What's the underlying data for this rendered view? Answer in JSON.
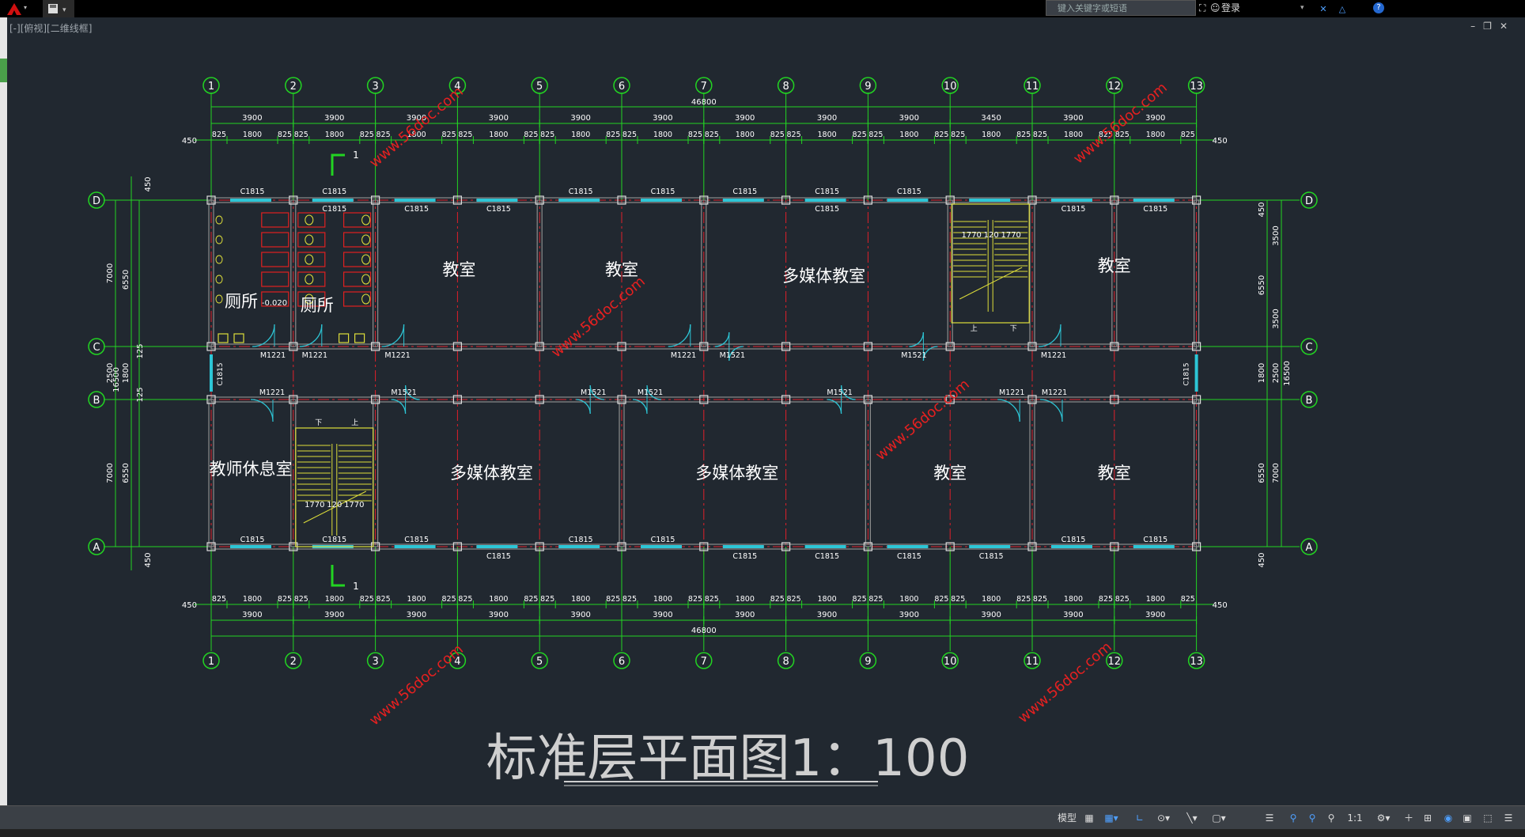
{
  "app": {
    "viewport_label": "[-][俯视][二维线框]",
    "search_placeholder": "键入关键字或短语",
    "login_label": "登录",
    "help_label": "?"
  },
  "drawing": {
    "title": "标准层平面图1：100",
    "watermark": "www.56doc.com",
    "column_axes": [
      "1",
      "2",
      "3",
      "4",
      "5",
      "6",
      "7",
      "8",
      "9",
      "10",
      "11",
      "12",
      "13"
    ],
    "row_axes": [
      "A",
      "B",
      "C",
      "D"
    ],
    "overall_length": "46800",
    "bay_dim": "3900",
    "top_bays": [
      "3900",
      "3900",
      "3900",
      "3900",
      "3900",
      "3900",
      "3900",
      "3900",
      "3900",
      "3900",
      "3900",
      "3900"
    ],
    "top_row_dims_top": [
      "3900",
      "3900",
      "3900",
      "3900",
      "3900",
      "3900",
      "3900",
      "3900",
      "3900",
      "3450",
      "3900",
      "3900"
    ],
    "window_seg_labels": [
      "450",
      "825",
      "1800",
      "825",
      "450",
      "825"
    ],
    "edge_dim": "450",
    "left_dims": [
      "7000",
      "2500",
      "7000"
    ],
    "left_dims_inner": [
      "6550",
      "1800",
      "6550"
    ],
    "overall_width": "16500",
    "right_dims_inner": [
      "3500",
      "3500"
    ],
    "corridor_inner": [
      "125",
      "125"
    ],
    "stair_dims": [
      "1770",
      "120",
      "1770"
    ],
    "level_mark": "-0.020",
    "stair_up": "上",
    "stair_down": "下",
    "section_mark": "1",
    "rooms": [
      {
        "name": "厕所",
        "key": "toilet1"
      },
      {
        "name": "厕所",
        "key": "toilet2"
      },
      {
        "name": "教室",
        "key": "class1"
      },
      {
        "name": "教室",
        "key": "class2"
      },
      {
        "name": "多媒体教室",
        "key": "media1"
      },
      {
        "name": "教室",
        "key": "class3"
      },
      {
        "name": "教师休息室",
        "key": "rest"
      },
      {
        "name": "多媒体教室",
        "key": "media2"
      },
      {
        "name": "多媒体教室",
        "key": "media3"
      },
      {
        "name": "教室",
        "key": "class4"
      },
      {
        "name": "教室",
        "key": "class5"
      }
    ],
    "window_codes": [
      "C1815"
    ],
    "door_codes": [
      "M1221",
      "M1521"
    ]
  },
  "statusbar": {
    "model_label": "模型",
    "scale_label": "1:1"
  },
  "colors": {
    "background": "#212830",
    "axis": "#22d422",
    "wall": "#8c8c8c",
    "axis_center": "#e0202a",
    "window": "#2dc6d6",
    "stair": "#dede3a",
    "fixture": "#e02020",
    "watermark": "#e62020",
    "text": "#ffffff"
  }
}
